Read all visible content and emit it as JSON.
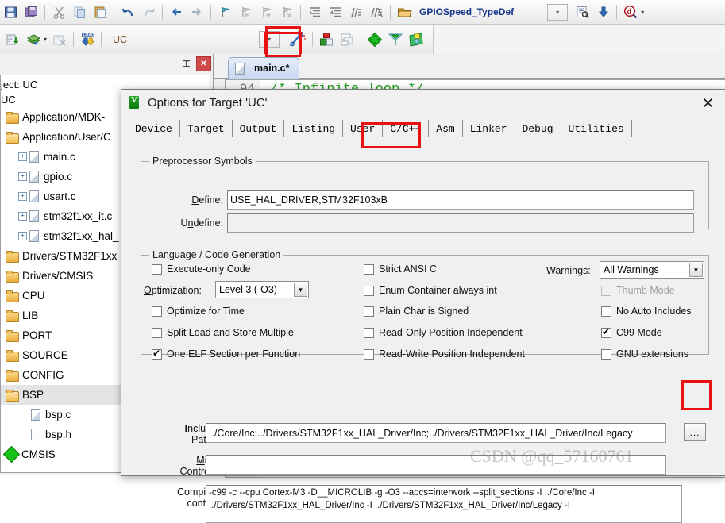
{
  "toolbar_main": {
    "items": [
      {
        "name": "save-icon",
        "label": ""
      },
      {
        "name": "save-all-icon",
        "label": ""
      },
      {
        "name": "cut-icon",
        "label": ""
      },
      {
        "name": "copy-icon",
        "label": ""
      },
      {
        "name": "paste-icon",
        "label": ""
      },
      {
        "name": "undo-icon",
        "label": ""
      },
      {
        "name": "redo-icon",
        "label": ""
      },
      {
        "name": "navigate-back-icon",
        "label": ""
      },
      {
        "name": "navigate-forward-icon",
        "label": ""
      },
      {
        "name": "bookmark-toggle-icon",
        "label": ""
      },
      {
        "name": "bookmark-prev-icon",
        "label": ""
      },
      {
        "name": "bookmark-next-icon",
        "label": ""
      },
      {
        "name": "bookmark-clear-icon",
        "label": ""
      },
      {
        "name": "indent-icon",
        "label": ""
      },
      {
        "name": "outdent-icon",
        "label": ""
      },
      {
        "name": "comment-icon",
        "label": ""
      },
      {
        "name": "uncomment-icon",
        "label": ""
      }
    ],
    "symbol_browse_icon": "open-folder-icon",
    "symbol_name": "GPIOSpeed_TypeDef",
    "combo_arrow": "chevron-down-icon",
    "find_in_files_icon": "find-in-files-icon",
    "insert_icon": "insert-down-icon",
    "debug_icon": "debug-magnifier-icon",
    "debug_dropdown": "chevron-down-icon"
  },
  "toolbar_build": {
    "translate_icon": "translate-file-icon",
    "build_icon": "build-target-icon",
    "build_dropdown": "chevron-down-icon",
    "rebuild_icon": "rebuild-all-icon",
    "load_icon": "load-icon",
    "target_name": "UC",
    "target_combo_arrow": "chevron-down-icon",
    "magic_wand_icon": "magic-wand-options-icon",
    "manage_components_icon": "manage-components-icon",
    "batch_build_icon": "batch-build-icon",
    "pack_installer_icon": "pack-installer-icon",
    "manage_rte_icon": "manage-rte-icon",
    "pack_update_icon": "pack-update-icon"
  },
  "project_panel": {
    "pin_icon": "pin-icon",
    "close_icon": "close-icon",
    "header_project": "ject: UC",
    "header_target": "UC",
    "tree": [
      {
        "label": "Application/MDK-",
        "icon": "folder-icon",
        "indent": 0,
        "expander": false,
        "selected": false
      },
      {
        "label": "Application/User/C",
        "icon": "folder-open-icon",
        "indent": 0,
        "expander": false,
        "selected": false
      },
      {
        "label": "main.c",
        "icon": "c-file-icon",
        "indent": 1,
        "expander": true,
        "selected": false
      },
      {
        "label": "gpio.c",
        "icon": "c-file-icon",
        "indent": 1,
        "expander": true,
        "selected": false
      },
      {
        "label": "usart.c",
        "icon": "c-file-icon",
        "indent": 1,
        "expander": true,
        "selected": false
      },
      {
        "label": "stm32f1xx_it.c",
        "icon": "c-file-icon",
        "indent": 1,
        "expander": true,
        "selected": false
      },
      {
        "label": "stm32f1xx_hal_",
        "icon": "c-file-icon",
        "indent": 1,
        "expander": true,
        "selected": false
      },
      {
        "label": "Drivers/STM32F1xx",
        "icon": "folder-icon",
        "indent": 0,
        "expander": false,
        "selected": false
      },
      {
        "label": "Drivers/CMSIS",
        "icon": "folder-icon",
        "indent": 0,
        "expander": false,
        "selected": false
      },
      {
        "label": "CPU",
        "icon": "folder-icon",
        "indent": 0,
        "expander": false,
        "selected": false
      },
      {
        "label": "LIB",
        "icon": "folder-icon",
        "indent": 0,
        "expander": false,
        "selected": false
      },
      {
        "label": "PORT",
        "icon": "folder-icon",
        "indent": 0,
        "expander": false,
        "selected": false
      },
      {
        "label": "SOURCE",
        "icon": "folder-icon",
        "indent": 0,
        "expander": false,
        "selected": false
      },
      {
        "label": "CONFIG",
        "icon": "folder-icon",
        "indent": 0,
        "expander": false,
        "selected": false
      },
      {
        "label": "BSP",
        "icon": "folder-open-icon",
        "indent": 0,
        "expander": false,
        "selected": true
      },
      {
        "label": "bsp.c",
        "icon": "c-file-icon",
        "indent": 1,
        "expander": false,
        "selected": false
      },
      {
        "label": "bsp.h",
        "icon": "h-file-icon",
        "indent": 1,
        "expander": false,
        "selected": false
      },
      {
        "label": "CMSIS",
        "icon": "cmsis-diamond-icon",
        "indent": 0,
        "expander": false,
        "selected": false
      }
    ]
  },
  "editor": {
    "tab_icon": "c-file-icon",
    "tab_label": "main.c*",
    "line_number": "94",
    "code_text": "/* Infinite loop */"
  },
  "dialog": {
    "logo_icon": "keil-logo-icon",
    "title": "Options for Target 'UC'",
    "close_icon": "close-icon",
    "tabs": [
      {
        "label": "Device",
        "active": false
      },
      {
        "label": "Target",
        "active": false
      },
      {
        "label": "Output",
        "active": false
      },
      {
        "label": "Listing",
        "active": false
      },
      {
        "label": "User",
        "active": false
      },
      {
        "label": "C/C++",
        "active": true
      },
      {
        "label": "Asm",
        "active": false
      },
      {
        "label": "Linker",
        "active": false
      },
      {
        "label": "Debug",
        "active": false
      },
      {
        "label": "Utilities",
        "active": false
      }
    ],
    "preprocessor": {
      "group_title": "Preprocessor Symbols",
      "define_label": "Define:",
      "define_value": "USE_HAL_DRIVER,STM32F103xB",
      "undefine_label": "Undefine:",
      "undefine_value": ""
    },
    "langgen": {
      "group_title": "Language / Code Generation",
      "left_checks": [
        {
          "label": "Execute-only Code",
          "checked": false,
          "disabled": false
        },
        {
          "label": "Optimize for Time",
          "checked": false,
          "disabled": false
        },
        {
          "label": "Split Load and Store Multiple",
          "checked": false,
          "disabled": false
        },
        {
          "label": "One ELF Section per Function",
          "checked": true,
          "disabled": false
        }
      ],
      "optimization_label": "Optimization:",
      "optimization_value": "Level 3 (-O3)",
      "middle_checks": [
        {
          "label": "Strict ANSI C",
          "checked": false,
          "disabled": false
        },
        {
          "label": "Enum Container always int",
          "checked": false,
          "disabled": false
        },
        {
          "label": "Plain Char is Signed",
          "checked": false,
          "disabled": false
        },
        {
          "label": "Read-Only Position Independent",
          "checked": false,
          "disabled": false
        },
        {
          "label": "Read-Write Position Independent",
          "checked": false,
          "disabled": false
        }
      ],
      "warnings_label": "Warnings:",
      "warnings_value": "All Warnings",
      "right_checks": [
        {
          "label": "Thumb Mode",
          "checked": false,
          "disabled": true
        },
        {
          "label": "No Auto Includes",
          "checked": false,
          "disabled": false
        },
        {
          "label": "C99 Mode",
          "checked": true,
          "disabled": false
        },
        {
          "label": "GNU extensions",
          "checked": false,
          "disabled": false
        }
      ]
    },
    "include_paths": {
      "label_line1": "Include",
      "label_line2": "Paths",
      "value": "../Core/Inc;../Drivers/STM32F1xx_HAL_Driver/Inc;../Drivers/STM32F1xx_HAL_Driver/Inc/Legacy",
      "browse_label": "..."
    },
    "misc_controls": {
      "label_line1": "Misc",
      "label_line2": "Controls",
      "value": ""
    },
    "compiler_control": {
      "label_line1": "Compiler",
      "label_line2": "control",
      "line1": "-c99 -c --cpu Cortex-M3 -D__MICROLIB -g -O3 --apcs=interwork --split_sections -I ../Core/Inc -I",
      "line2": "../Drivers/STM32F1xx_HAL_Driver/Inc -I ../Drivers/STM32F1xx_HAL_Driver/Inc/Legacy -I"
    }
  },
  "watermark": {
    "text": "CSDN @qq_57160761"
  },
  "colors": {
    "accent_red": "#e81010",
    "dialog_bg": "#f0f0f0",
    "code_comment": "#1a9f1a",
    "toolbar_label": "#16368c",
    "target_label": "#7c4b16"
  }
}
